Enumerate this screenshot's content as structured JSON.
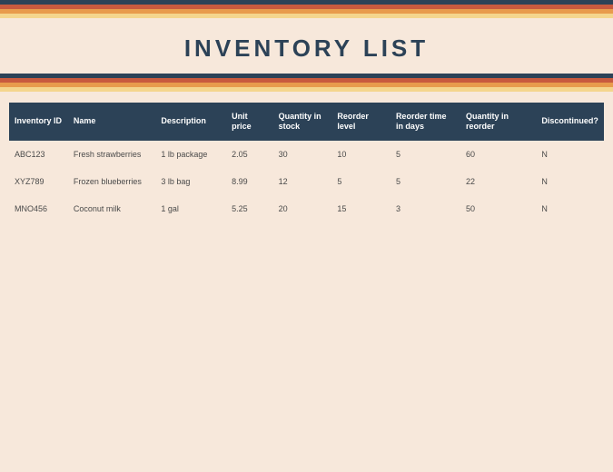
{
  "title": "INVENTORY LIST",
  "columns": {
    "inventory_id": "Inventory ID",
    "name": "Name",
    "description": "Description",
    "unit_price": "Unit price",
    "quantity_in_stock": "Quantity in stock",
    "reorder_level": "Reorder level",
    "reorder_time": "Reorder time in days",
    "quantity_in_reorder": "Quantity in reorder",
    "discontinued": "Discontinued?"
  },
  "rows": [
    {
      "inventory_id": "ABC123",
      "name": "Fresh strawberries",
      "description": "1 lb package",
      "unit_price": "2.05",
      "quantity_in_stock": "30",
      "reorder_level": "10",
      "reorder_time": "5",
      "quantity_in_reorder": "60",
      "discontinued": "N"
    },
    {
      "inventory_id": "XYZ789",
      "name": "Frozen blueberries",
      "description": "3 lb bag",
      "unit_price": "8.99",
      "quantity_in_stock": "12",
      "reorder_level": "5",
      "reorder_time": "5",
      "quantity_in_reorder": "22",
      "discontinued": "N"
    },
    {
      "inventory_id": "MNO456",
      "name": "Coconut milk",
      "description": "1 gal",
      "unit_price": "5.25",
      "quantity_in_stock": "20",
      "reorder_level": "15",
      "reorder_time": "3",
      "quantity_in_reorder": "50",
      "discontinued": "N"
    }
  ]
}
